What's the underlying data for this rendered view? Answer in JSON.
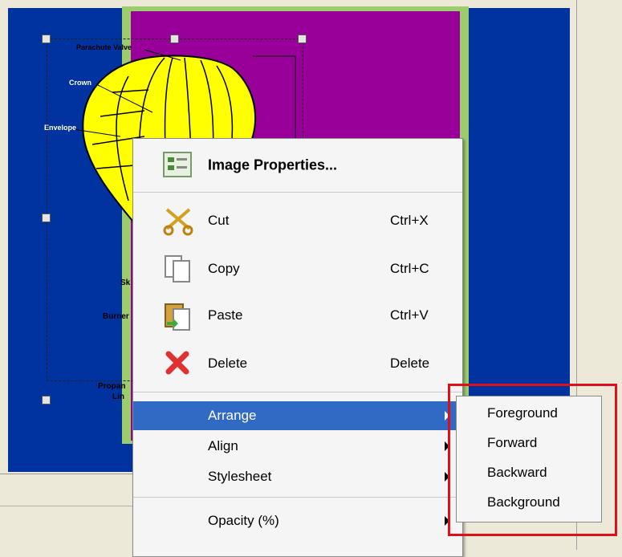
{
  "context_menu": {
    "image_properties": "Image Properties...",
    "items": [
      {
        "label": "Cut",
        "shortcut": "Ctrl+X",
        "icon": "scissors-icon"
      },
      {
        "label": "Copy",
        "shortcut": "Ctrl+C",
        "icon": "copy-icon"
      },
      {
        "label": "Paste",
        "shortcut": "Ctrl+V",
        "icon": "paste-icon"
      },
      {
        "label": "Delete",
        "shortcut": "Delete",
        "icon": "delete-x-icon"
      }
    ],
    "arrange": "Arrange",
    "align": "Align",
    "stylesheet": "Stylesheet",
    "opacity": "Opacity (%)"
  },
  "submenu": {
    "items": [
      "Foreground",
      "Forward",
      "Backward",
      "Background"
    ]
  },
  "colors": {
    "slide_blue": "#0033a0",
    "purple": "#990099",
    "green_border": "#9ccc6c",
    "balloon_yellow": "#ffff00",
    "highlight": "#316ac5",
    "callout_red": "#e0101a"
  },
  "diagram_labels": {
    "top": "Parachute Valve",
    "a": "Crown",
    "b": "Envelope",
    "c": "Sk",
    "d": "Burner",
    "e": "Propan",
    "f": "Lin"
  }
}
